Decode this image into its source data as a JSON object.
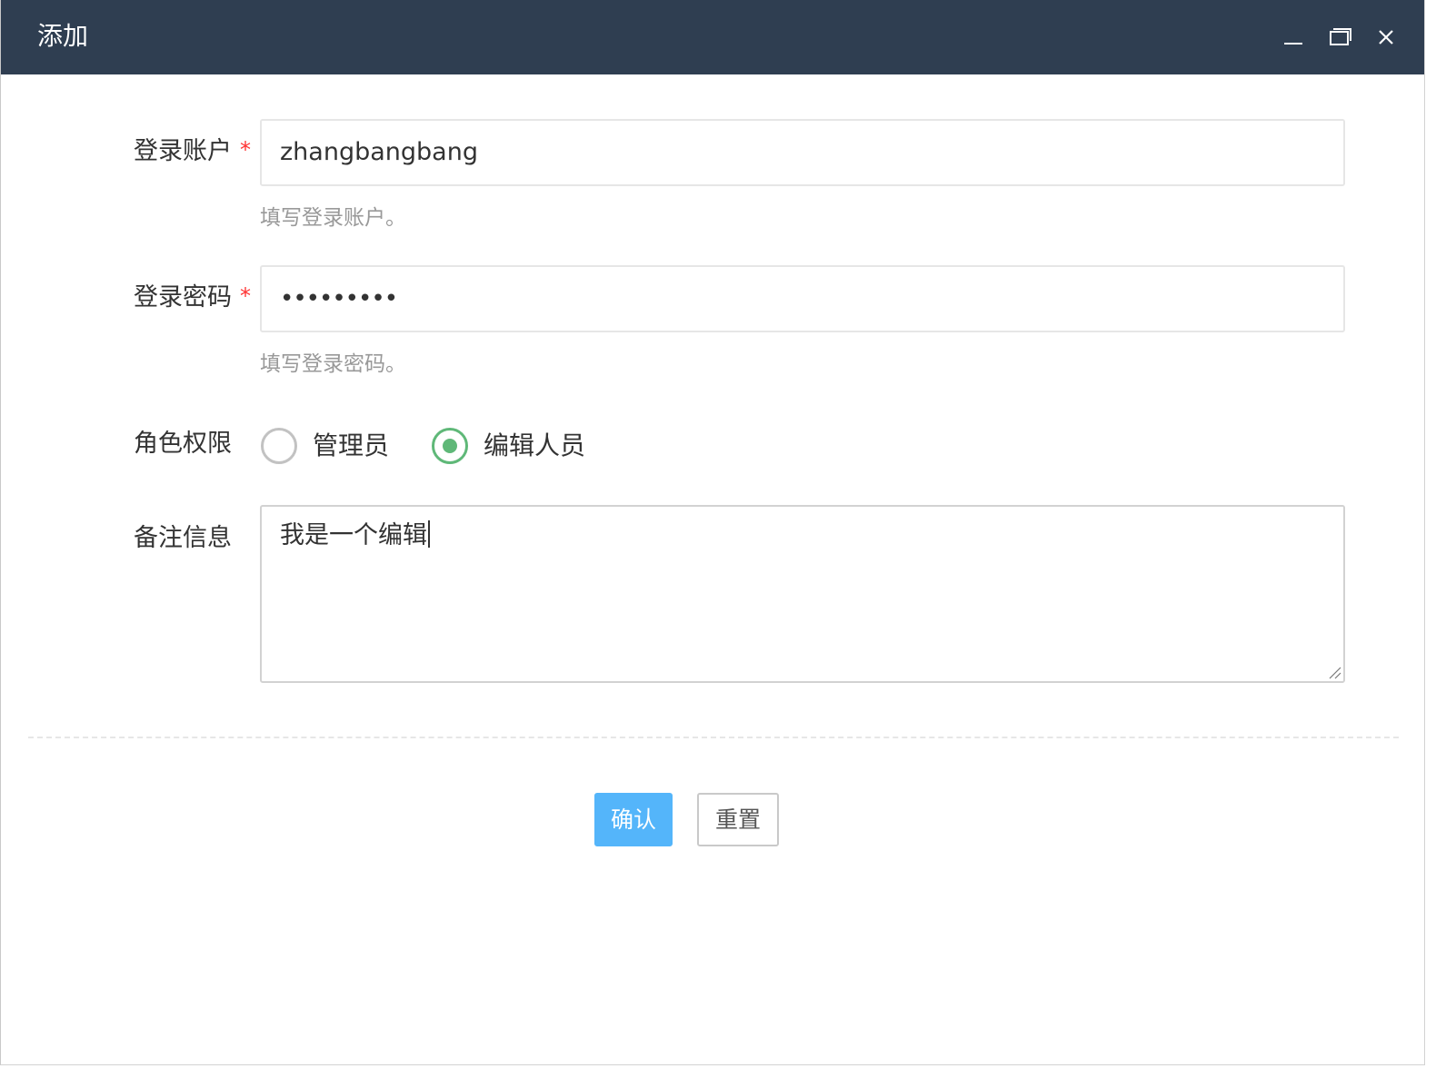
{
  "window": {
    "title": "添加",
    "controls": [
      "minimize-icon",
      "maximize-icon",
      "close-icon"
    ]
  },
  "form": {
    "account": {
      "label": "登录账户",
      "required_mark": "*",
      "value": "zhangbangbang",
      "hint": "填写登录账户。"
    },
    "password": {
      "label": "登录密码",
      "required_mark": "*",
      "value_masked": "•••••••••",
      "hint": "填写登录密码。"
    },
    "role": {
      "label": "角色权限",
      "options": [
        {
          "label": "管理员",
          "checked": false
        },
        {
          "label": "编辑人员",
          "checked": true
        }
      ]
    },
    "remark": {
      "label": "备注信息",
      "value": "我是一个编辑"
    }
  },
  "actions": {
    "confirm_label": "确认",
    "reset_label": "重置"
  },
  "colors": {
    "titlebar": "#2f3e51",
    "primary": "#54b5fa",
    "radio_checked": "#5fb878",
    "required": "#ff3333"
  }
}
